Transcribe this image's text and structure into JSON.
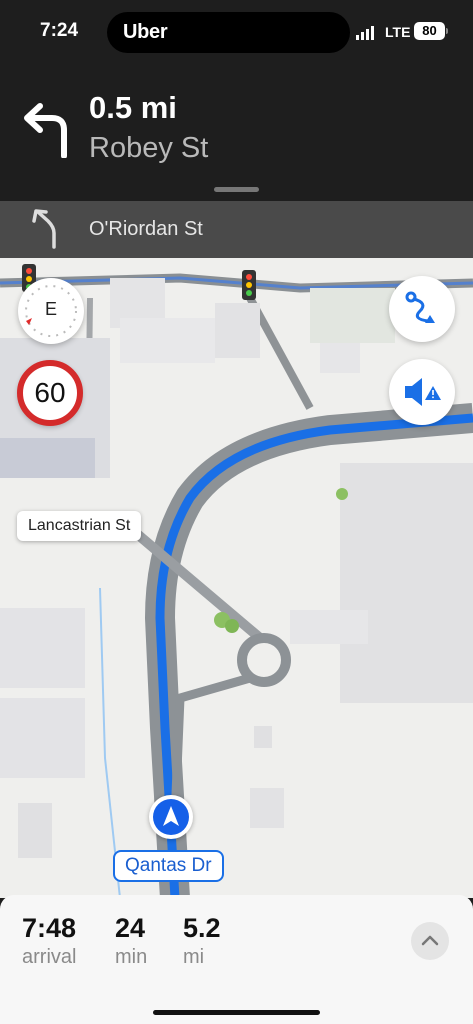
{
  "status_bar": {
    "time": "7:24",
    "app_name": "Uber",
    "network": "LTE",
    "battery": "80"
  },
  "instruction": {
    "distance": "0.5 mi",
    "street": "Robey St",
    "turn_direction": "left"
  },
  "next_turn": {
    "street": "O'Riordan St",
    "turn_direction": "slight-left"
  },
  "map": {
    "compass_heading": "E",
    "speed_limit": "60",
    "street_callout": "Lancastrian St",
    "current_road": "Qantas Dr",
    "route_color": "#1a6fe6",
    "buttons": [
      "route-overview",
      "audio-alerts"
    ]
  },
  "trip": {
    "arrival_value": "7:48",
    "arrival_label": "arrival",
    "duration_value": "24",
    "duration_label": "min",
    "distance_value": "5.2",
    "distance_label": "mi"
  },
  "colors": {
    "header_bg": "#1e1e1e",
    "next_bar_bg": "#4a4a4a",
    "accent_blue": "#1a6fe6",
    "speed_ring": "#d42b2b"
  }
}
